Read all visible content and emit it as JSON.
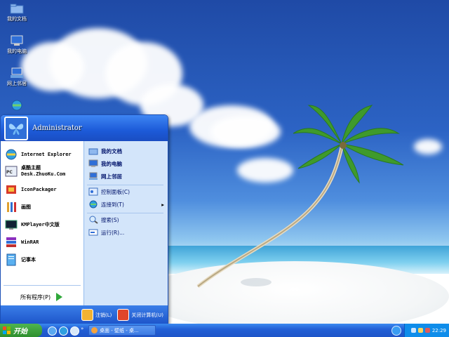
{
  "desktop": {
    "icons": [
      {
        "label": "我的文档",
        "icon": "folder-icon"
      },
      {
        "label": "我的电脑",
        "icon": "computer-icon"
      },
      {
        "label": "网上邻居",
        "icon": "network-icon"
      },
      {
        "label": "",
        "icon": "internet-explorer-icon"
      }
    ]
  },
  "start_menu": {
    "username": "Administrator",
    "left_items": [
      {
        "label": "Internet Explorer",
        "icon": "internet-explorer-icon"
      },
      {
        "label": "桌酷主题",
        "label2": "Desk.ZhuoKu.Com",
        "icon": "theme-icon"
      },
      {
        "label": "IconPackager",
        "icon": "iconpackager-icon"
      },
      {
        "label": "画图",
        "icon": "paint-icon"
      },
      {
        "label": "KMPlayer中文版",
        "icon": "kmplayer-icon"
      },
      {
        "label": "WinRAR",
        "icon": "winrar-icon"
      },
      {
        "label": "记事本",
        "icon": "notepad-icon"
      }
    ],
    "all_programs": "所有程序(P)",
    "right_items": [
      {
        "label": "我的文档",
        "icon": "folder-icon"
      },
      {
        "label": "我的电脑",
        "icon": "computer-icon"
      },
      {
        "label": "网上邻居",
        "icon": "network-icon"
      },
      {
        "label": "控制面板(C)",
        "icon": "control-panel-icon"
      },
      {
        "label": "连接到(T)",
        "icon": "connect-icon"
      },
      {
        "label": "搜索(S)",
        "icon": "search-icon"
      },
      {
        "label": "运行(R)...",
        "icon": "run-icon"
      }
    ],
    "logoff": "注销(L)",
    "shutdown": "关闭计算机(U)"
  },
  "taskbar": {
    "start_label": "开始",
    "task_label": "桌面 - 壁纸 - 桌...",
    "clock": "22:29"
  },
  "colors": {
    "start_green": "#2e8f2e",
    "taskbar_blue": "#2360d6",
    "menu_blue": "#1c5ad8"
  }
}
